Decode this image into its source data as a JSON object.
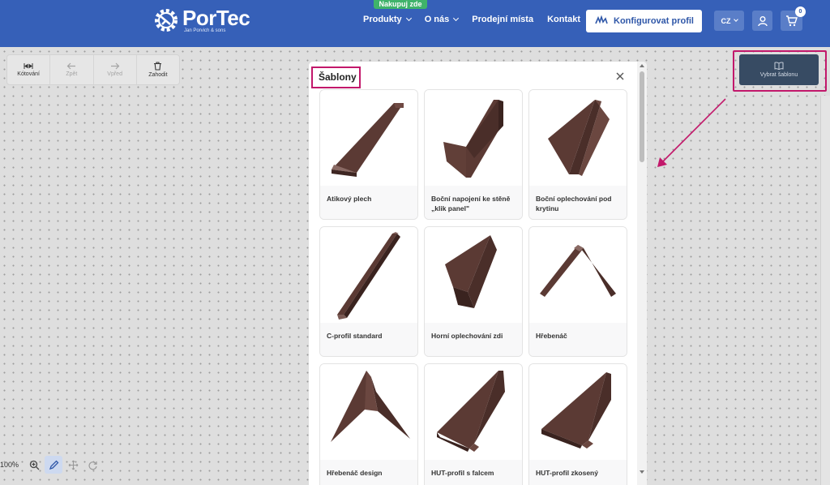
{
  "header": {
    "logo_title": "PorTec",
    "logo_subtitle": "Jan Porvich & sons",
    "promo_badge": "Nakupuj zde",
    "nav": [
      {
        "label": "Produkty",
        "has_dropdown": true
      },
      {
        "label": "O nás",
        "has_dropdown": true
      },
      {
        "label": "Prodejní místa",
        "has_dropdown": false
      },
      {
        "label": "Kontakt",
        "has_dropdown": false
      }
    ],
    "config_button": "Konfigurovat profil",
    "language": "CZ",
    "cart_count": "0"
  },
  "toolbar": {
    "items": [
      {
        "label": "Kótování",
        "icon": "dimension-icon",
        "enabled": true
      },
      {
        "label": "Zpět",
        "icon": "arrow-left-icon",
        "enabled": false
      },
      {
        "label": "Vpřed",
        "icon": "arrow-right-icon",
        "enabled": false
      },
      {
        "label": "Zahodit",
        "icon": "trash-icon",
        "enabled": true
      }
    ]
  },
  "template_button": {
    "label": "Vybrat šablonu",
    "icon": "book-icon"
  },
  "zoom": {
    "label": "100%"
  },
  "modal": {
    "title": "Šablony",
    "items": [
      {
        "label": "Atikový plech"
      },
      {
        "label": "Boční napojení ke stěně „klik panel\""
      },
      {
        "label": "Boční oplechování pod krytinu"
      },
      {
        "label": "C-profil standard"
      },
      {
        "label": "Horní oplechování zdi"
      },
      {
        "label": "Hřebenáč"
      },
      {
        "label": "Hřebenáč design"
      },
      {
        "label": "HUT-profil s falcem"
      },
      {
        "label": "HUT-profil zkosený"
      }
    ]
  },
  "colors": {
    "header_bg": "#3660b8",
    "accent_highlight": "#c2186b",
    "metal_brown": "#5b3a34",
    "template_button_bg": "#374b63",
    "promo_green": "#3fb36a"
  }
}
